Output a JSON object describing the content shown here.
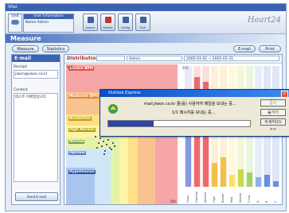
{
  "window": {
    "title": "Vital"
  },
  "toolbar": {
    "unit_label": "Unit",
    "user_info": {
      "header": "User Information",
      "name_row": "Name  Admin"
    },
    "buttons": [
      {
        "label": "Search",
        "icon": "search-icon"
      },
      {
        "label": "Patient",
        "icon": "patient-icon"
      },
      {
        "label": "Config",
        "icon": "config-icon"
      },
      {
        "label": "Exit",
        "icon": "exit-icon"
      }
    ],
    "brand": "Heart24"
  },
  "section": {
    "title": "Measure"
  },
  "nav": {
    "measure": "Measure",
    "statistics": "Statistics",
    "email": "E-mail",
    "print": "Print"
  },
  "email_panel": {
    "title": "E-mail",
    "receipt_label": "Receipt",
    "receipt_value": "jiwon@jiwon.co.kr",
    "content_label": "Content",
    "content_value": "테스트 이메일입니다.",
    "send_button": "Send E-mail"
  },
  "chart_header": {
    "title": "Distribution",
    "cell1": "",
    "cell2": "Admin",
    "cell3": "2005-01-01 ~ 2005-01-31"
  },
  "chart_data": {
    "type": "scatter",
    "zones": [
      {
        "name": "Severe BPH"
      },
      {
        "name": "Moderate BPH"
      },
      {
        "name": "Borderline"
      },
      {
        "name": "High Normal"
      },
      {
        "name": "Normal"
      },
      {
        "name": "Optimal"
      },
      {
        "name": "Hypotension"
      }
    ],
    "bar_values": [
      0.5,
      0.92,
      0.88,
      0.2,
      0.25,
      0.1,
      0.15,
      0.12,
      0.08,
      0.1,
      0.05
    ],
    "bar_colors": [
      "#8899dd",
      "#ee6a6a",
      "#ee6a6a",
      "#f3c14a",
      "#f3c14a",
      "#ffe066",
      "#c9d94a",
      "#9fd36b",
      "#8fb0e6",
      "#6a8fe0",
      "#6a8fe0"
    ],
    "x_labels": [
      "Hypo",
      "Optimal",
      "Normal",
      "High",
      "Border",
      "Mod",
      "Severe",
      "Crisis",
      "A",
      "B",
      "C"
    ],
    "y_unit": "SYS",
    "x_unit": "DIA"
  },
  "dialog": {
    "title": "Outlook Express",
    "message": "mail.jiwon.co.kr 쿨(를) 사용하여 메일을 보내는 중...",
    "status": "1/1 메시지를 보내는 중...",
    "progress": 0.32,
    "buttons": {
      "stop": "중지",
      "hide": "숨기기",
      "details": "자세히(D) >>"
    }
  }
}
